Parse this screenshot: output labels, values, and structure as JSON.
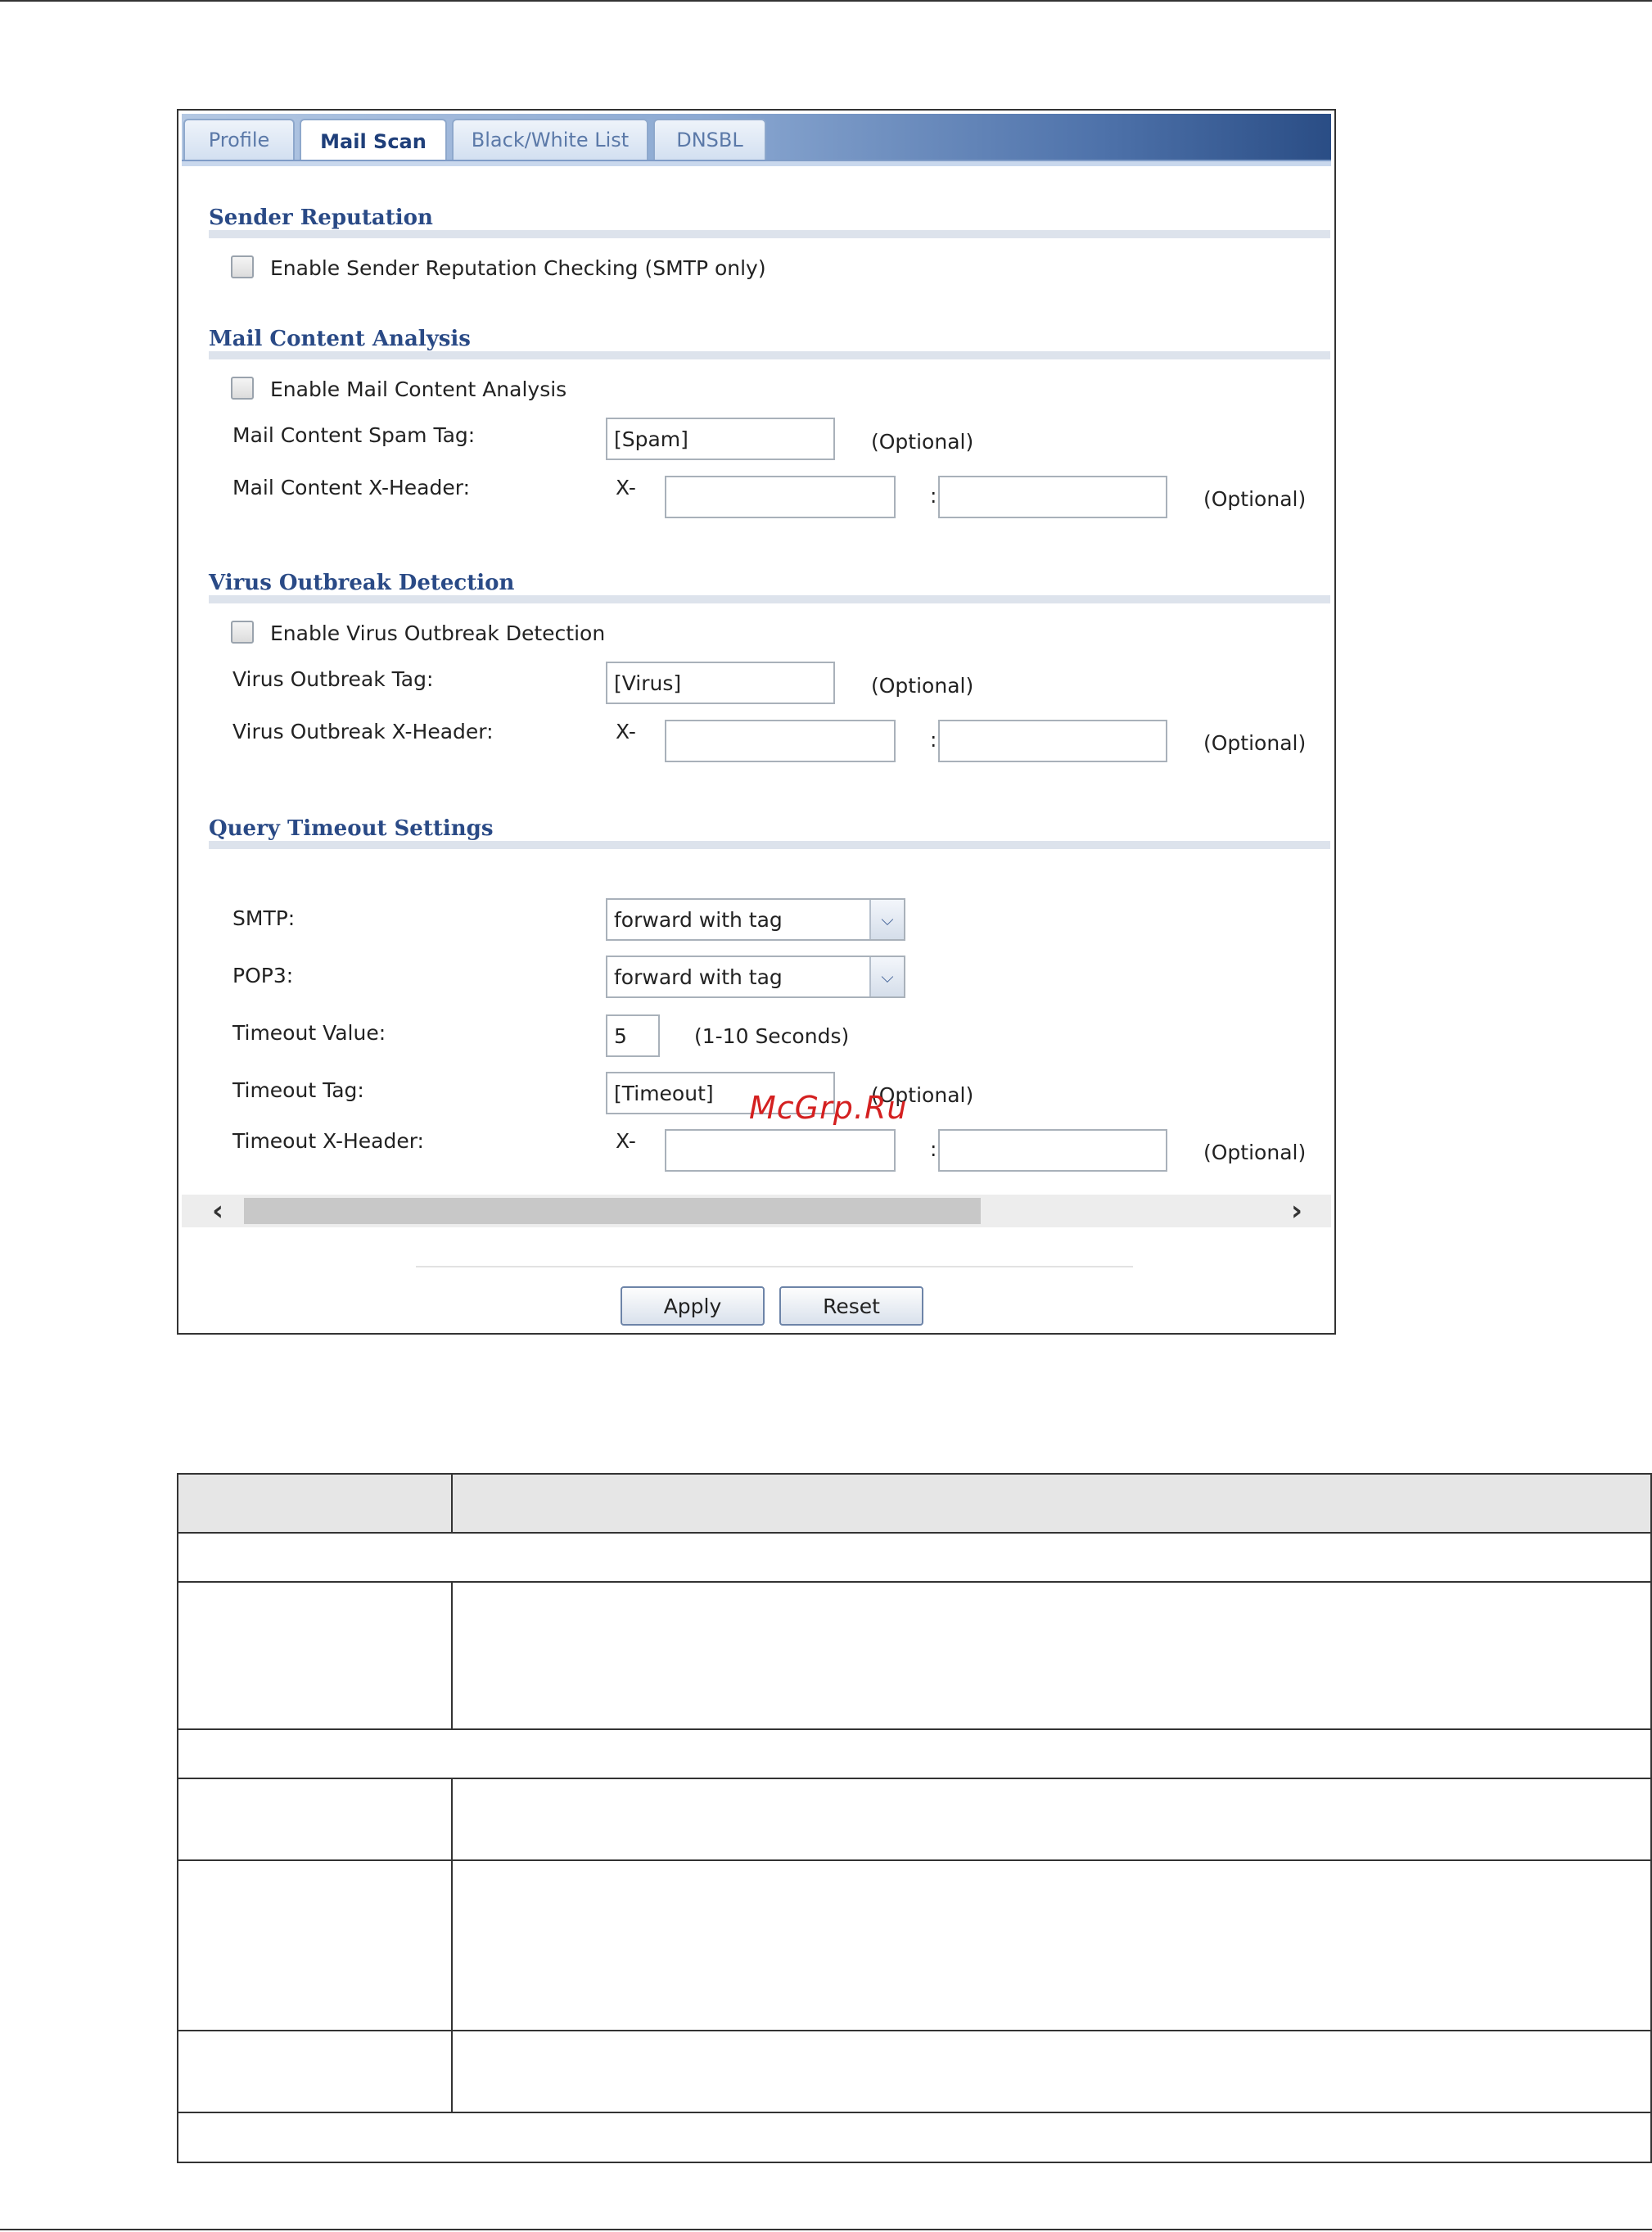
{
  "tabs": [
    {
      "label": "Profile",
      "active": false
    },
    {
      "label": "Mail Scan",
      "active": true
    },
    {
      "label": "Black/White List",
      "active": false
    },
    {
      "label": "DNSBL",
      "active": false
    }
  ],
  "sender_reputation": {
    "title": "Sender Reputation",
    "enable_label": "Enable Sender Reputation Checking (SMTP only)",
    "enabled": false
  },
  "mail_content": {
    "title": "Mail Content Analysis",
    "enable_label": "Enable Mail Content Analysis",
    "enabled": false,
    "spam_tag_label": "Mail Content Spam Tag:",
    "spam_tag_value": "[Spam]",
    "optional": "(Optional)",
    "xheader_label": "Mail Content X-Header:",
    "x_prefix": "X-",
    "colon": ":",
    "xheader_name": "",
    "xheader_value": ""
  },
  "virus": {
    "title": "Virus Outbreak Detection",
    "enable_label": "Enable Virus Outbreak Detection",
    "enabled": false,
    "tag_label": "Virus Outbreak Tag:",
    "tag_value": "[Virus]",
    "optional": "(Optional)",
    "xheader_label": "Virus Outbreak X-Header:",
    "x_prefix": "X-",
    "colon": ":",
    "xheader_name": "",
    "xheader_value": ""
  },
  "query_timeout": {
    "title": "Query Timeout Settings",
    "smtp_label": "SMTP:",
    "smtp_value": "forward with tag",
    "pop3_label": "POP3:",
    "pop3_value": "forward with tag",
    "timeout_value_label": "Timeout Value:",
    "timeout_value": "5",
    "timeout_range": "(1-10 Seconds)",
    "timeout_tag_label": "Timeout Tag:",
    "timeout_tag_value": "[Timeout]",
    "optional": "(Optional)",
    "xheader_label": "Timeout X-Header:",
    "x_prefix": "X-",
    "colon": ":",
    "xheader_name": "",
    "xheader_value": ""
  },
  "buttons": {
    "apply": "Apply",
    "reset": "Reset"
  },
  "watermark": "McGrp.Ru",
  "icons": {
    "dropdown": "chevron-down-icon",
    "scroll_left": "chevron-left-icon",
    "scroll_right": "chevron-right-icon"
  }
}
